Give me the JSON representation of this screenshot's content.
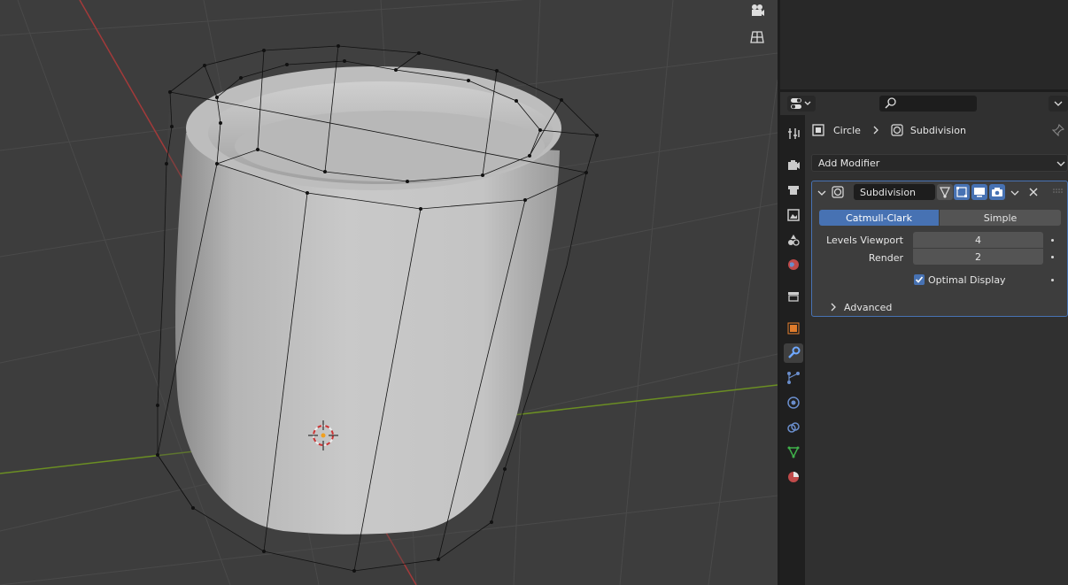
{
  "breadcrumb": {
    "object": "Circle",
    "modifier": "Subdivision"
  },
  "add_modifier": "Add Modifier",
  "modifier": {
    "name": "Subdivision",
    "tabs": [
      "Catmull-Clark",
      "Simple"
    ],
    "active_tab": "Catmull-Clark",
    "levels_viewport_label": "Levels Viewport",
    "levels_viewport": "4",
    "render_label": "Render",
    "render": "2",
    "optimal_display_label": "Optimal Display",
    "optimal_display": true,
    "advanced_label": "Advanced"
  },
  "colors": {
    "accent": "#4772b3",
    "x_axis": "#a33a3a",
    "y_axis": "#6b8e23",
    "active_tab_icon": "#6fa8ff"
  },
  "property_tabs": [
    "tool-icon",
    "render-icon",
    "output-icon",
    "view-layer-icon",
    "scene-icon",
    "world-icon",
    "collection-icon",
    "object-icon",
    "modifier-icon",
    "particles-icon",
    "physics-icon",
    "constraints-icon",
    "data-icon",
    "material-icon"
  ]
}
